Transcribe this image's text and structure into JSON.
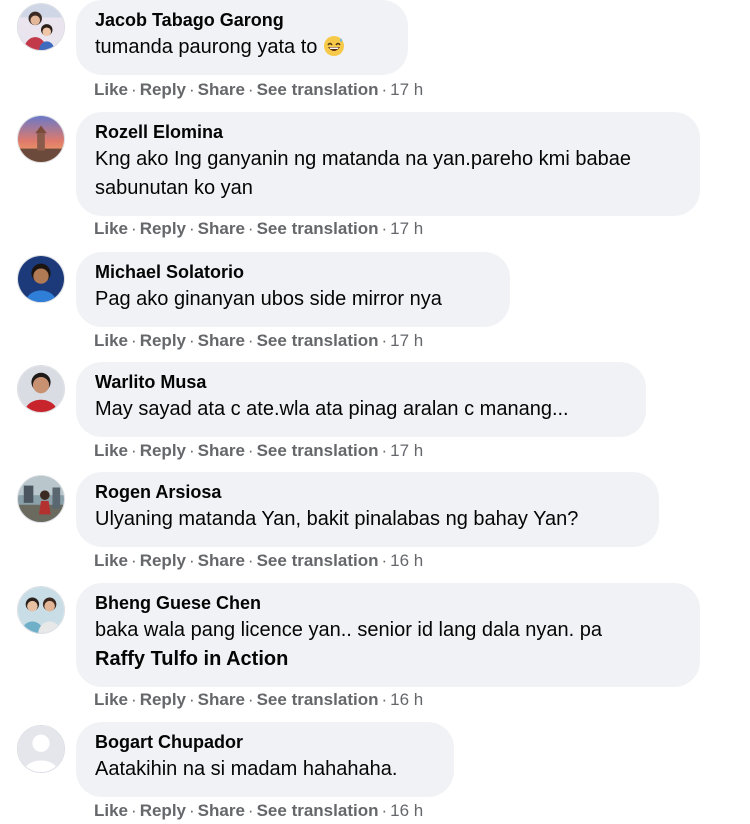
{
  "comments": [
    {
      "author": "Jacob Tabago Garong",
      "text": "tumanda paurong yata to",
      "emoji": "grinning-sweat-emoji",
      "avatar": "avatar-mother-child",
      "time": "17 h"
    },
    {
      "author": "Rozell Elomina",
      "text": "Kng ako Ing ganyanin ng matanda na yan.pareho kmi babae sabunutan ko yan",
      "avatar": "avatar-sunset",
      "time": "17 h"
    },
    {
      "author": "Michael Solatorio",
      "text": "Pag ako ginanyan ubos side mirror nya",
      "avatar": "avatar-boy-blue",
      "time": "17 h"
    },
    {
      "author": "Warlito Musa",
      "text": "May sayad ata c ate.wla ata pinag aralan c manang...",
      "avatar": "avatar-man-red",
      "time": "17 h"
    },
    {
      "author": "Rogen Arsiosa",
      "text": "Ulyaning matanda Yan, bakit pinalabas ng bahay Yan?",
      "avatar": "avatar-outdoor",
      "time": "16 h"
    },
    {
      "author": "Bheng Guese Chen",
      "text": "baka wala pang licence yan.. senior id lang dala nyan. pa",
      "mention": "Raffy Tulfo in Action",
      "avatar": "avatar-two-people",
      "time": "16 h"
    },
    {
      "author": "Bogart Chupador",
      "text": "Aatakihin na si madam hahahaha.",
      "avatar": "avatar-default",
      "time": "16 h"
    }
  ],
  "actions": {
    "like": "Like",
    "reply": "Reply",
    "share": "Share",
    "translate": "See translation",
    "sep": "·"
  },
  "colors": {
    "bubble": "#f0f2f5",
    "text": "#050505",
    "meta": "#65676b"
  }
}
